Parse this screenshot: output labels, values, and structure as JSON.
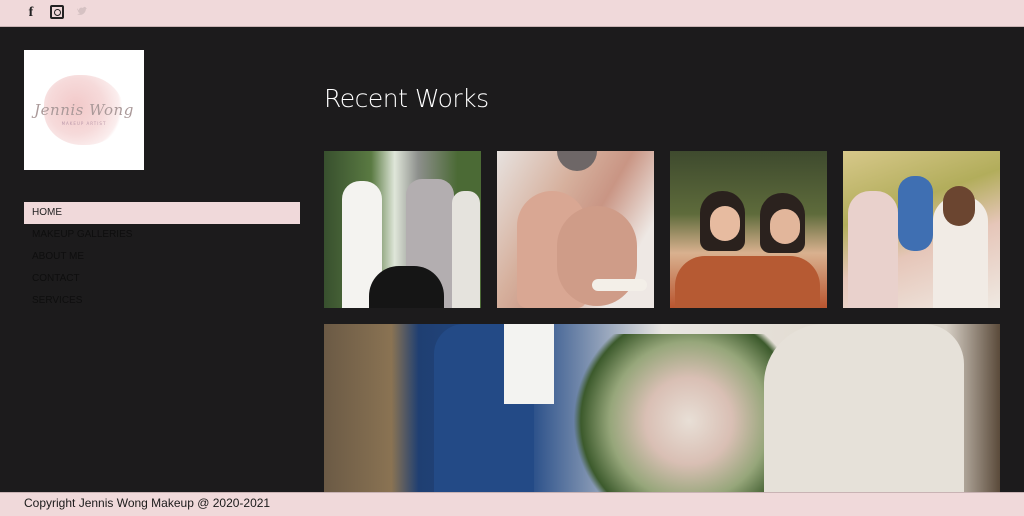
{
  "social": {
    "facebook_glyph": "f",
    "icons": [
      "facebook-icon",
      "instagram-icon",
      "twitter-icon"
    ]
  },
  "logo": {
    "script_text": "Jennis Wong",
    "subtitle": "MAKEUP ARTIST"
  },
  "nav": {
    "items": [
      {
        "label": "HOME",
        "active": true
      },
      {
        "label": "MAKEUP GALLERIES",
        "active": false
      },
      {
        "label": "ABOUT ME",
        "active": false
      },
      {
        "label": "CONTACT",
        "active": false
      },
      {
        "label": "SERVICES",
        "active": false
      }
    ]
  },
  "main": {
    "heading": "Recent Works"
  },
  "footer": {
    "copyright": "Copyright Jennis Wong Makeup @ 2020-2021"
  },
  "colors": {
    "background": "#1c1b1c",
    "accent_pink": "#f0d9da",
    "heading_text": "#ffffff"
  }
}
